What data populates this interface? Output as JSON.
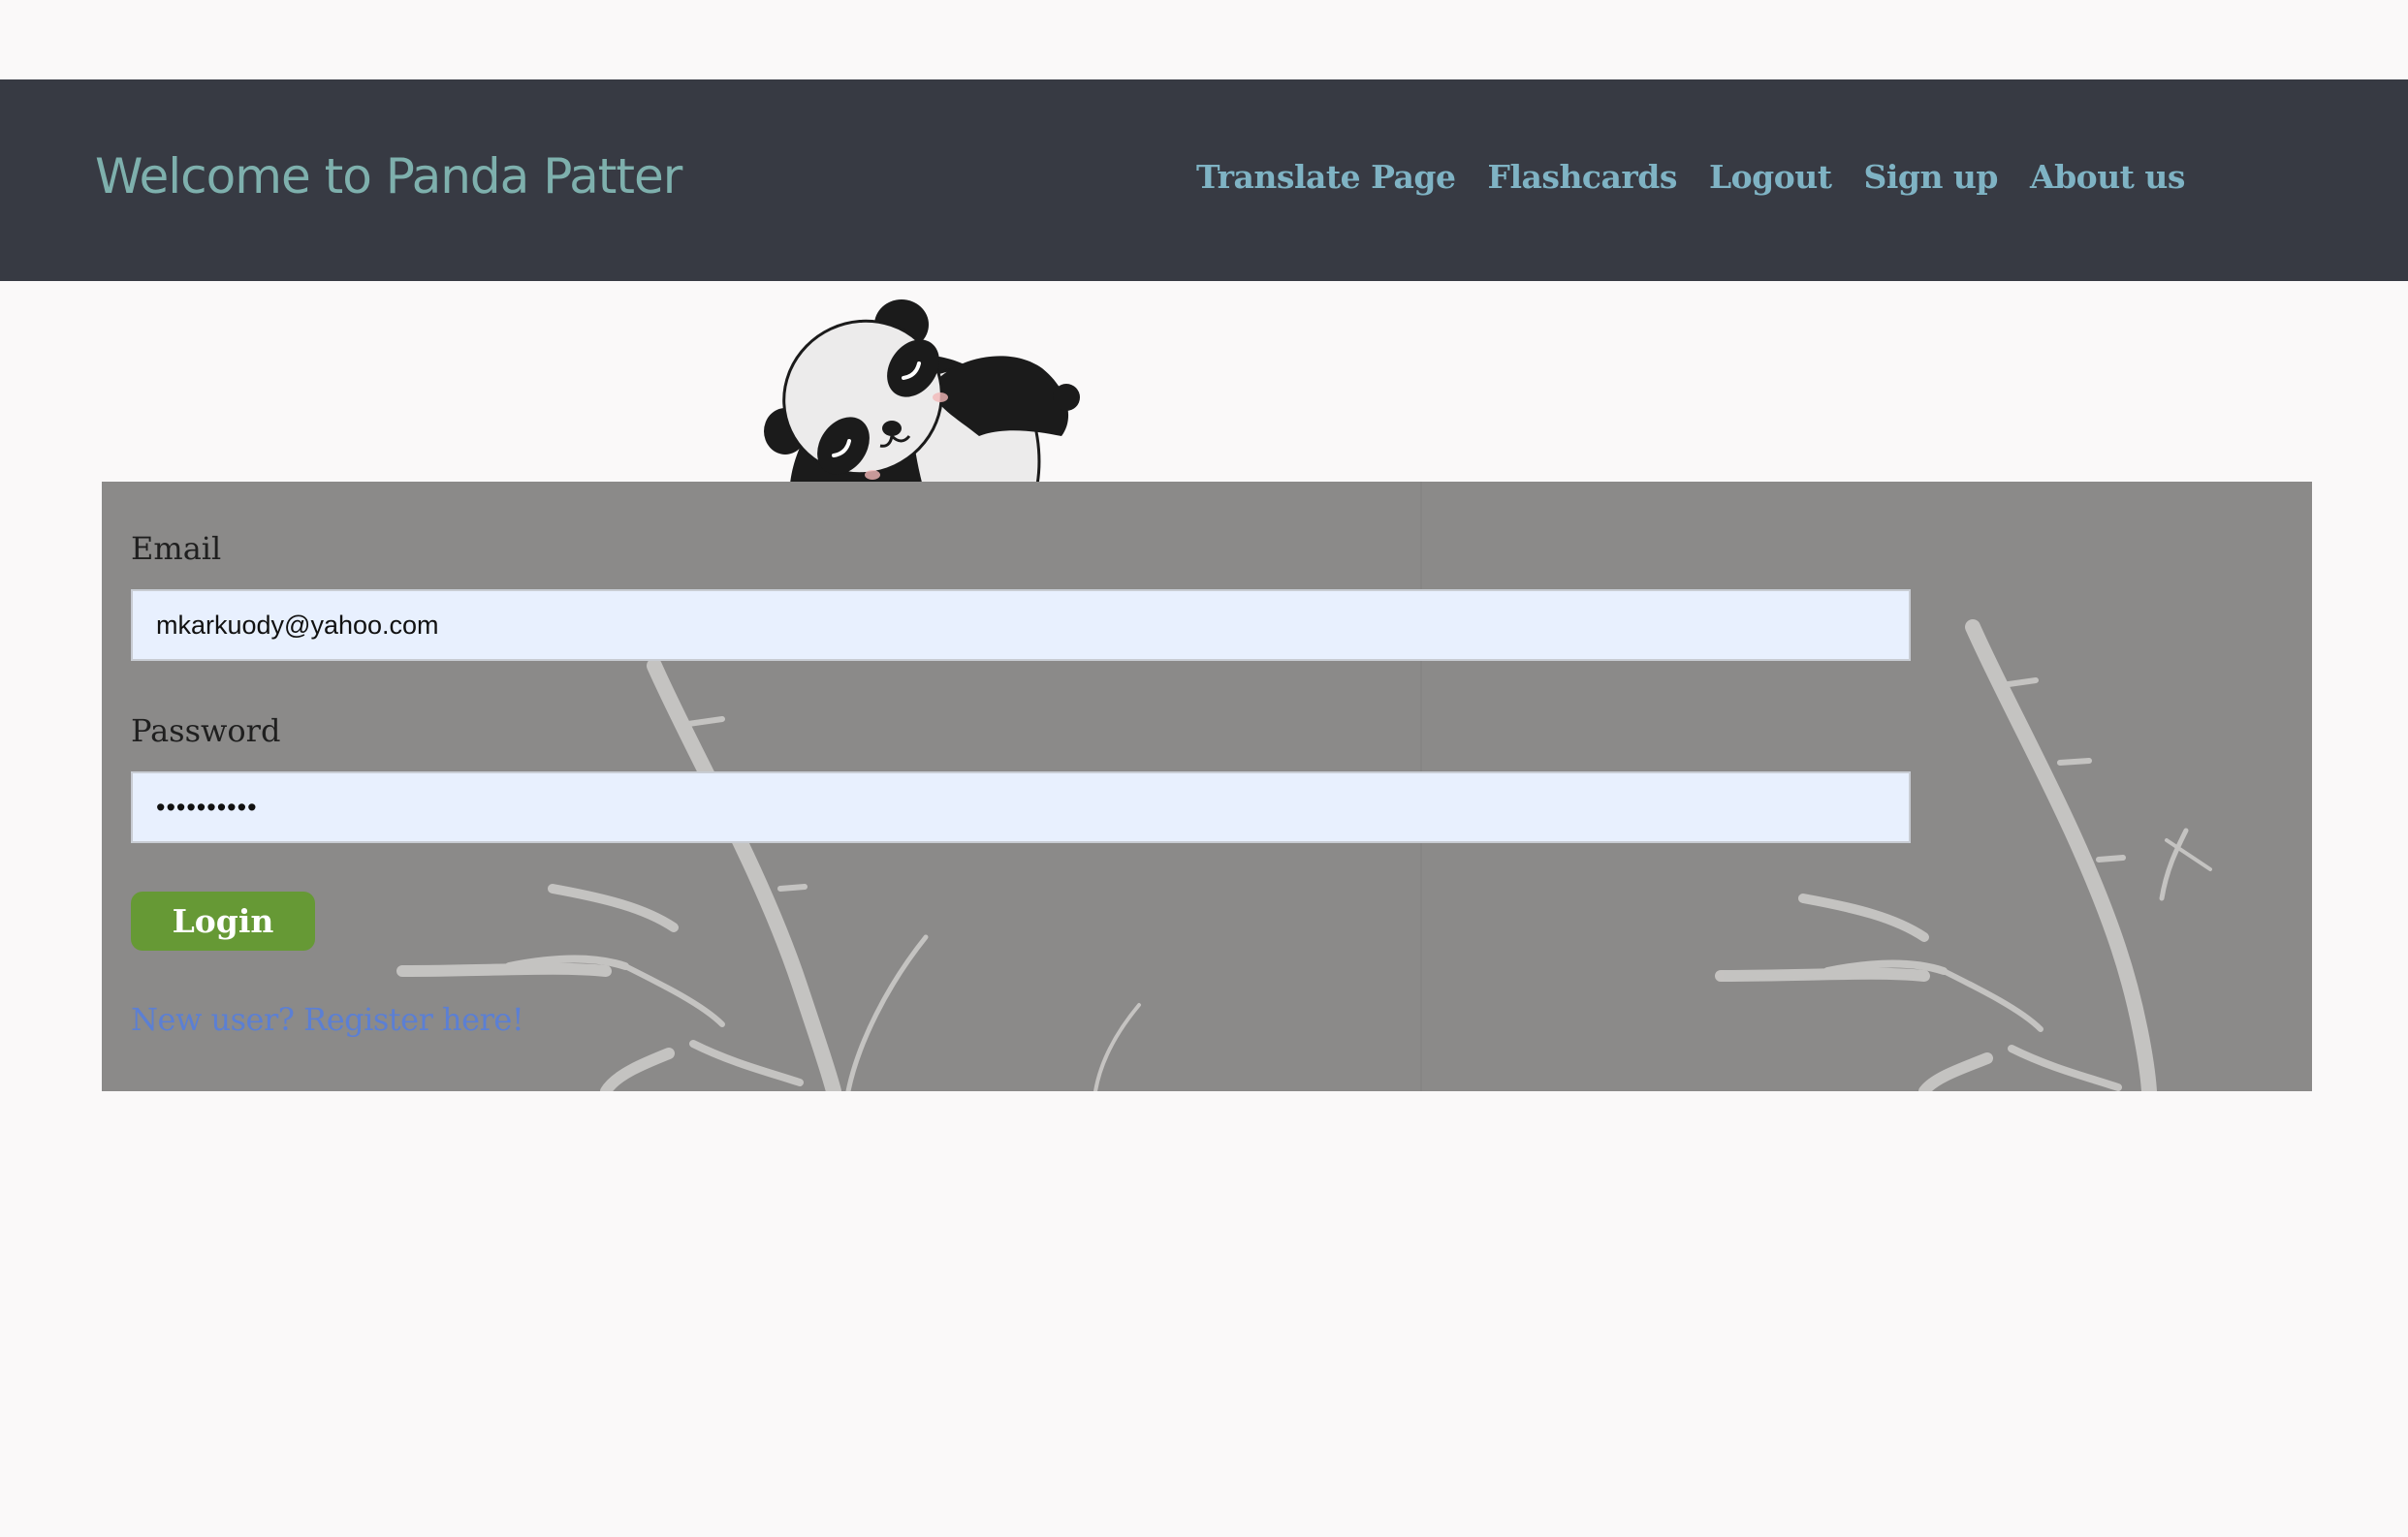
{
  "header": {
    "title": "Welcome to Panda Patter",
    "nav": [
      {
        "label": "Translate Page"
      },
      {
        "label": "Flashcards"
      },
      {
        "label": "Logout"
      },
      {
        "label": "Sign up"
      },
      {
        "label": "About us"
      }
    ]
  },
  "login_form": {
    "email_label": "Email",
    "email_value": "mkarkuody@yahoo.com",
    "password_label": "Password",
    "password_value": "••••••••••",
    "login_label": "Login",
    "register_link": "New user? Register here!"
  },
  "colors": {
    "header_bg": "#373a43",
    "title_color": "#7eb0ad",
    "nav_color": "#7fb3c4",
    "panel_bg": "#8b8a89",
    "input_bg": "#e8f0fe",
    "button_bg": "#669935",
    "link_color": "#5b7fd4"
  },
  "icons": {
    "mascot": "sleeping-panda-illustration",
    "background": "bamboo-ink-pattern"
  }
}
